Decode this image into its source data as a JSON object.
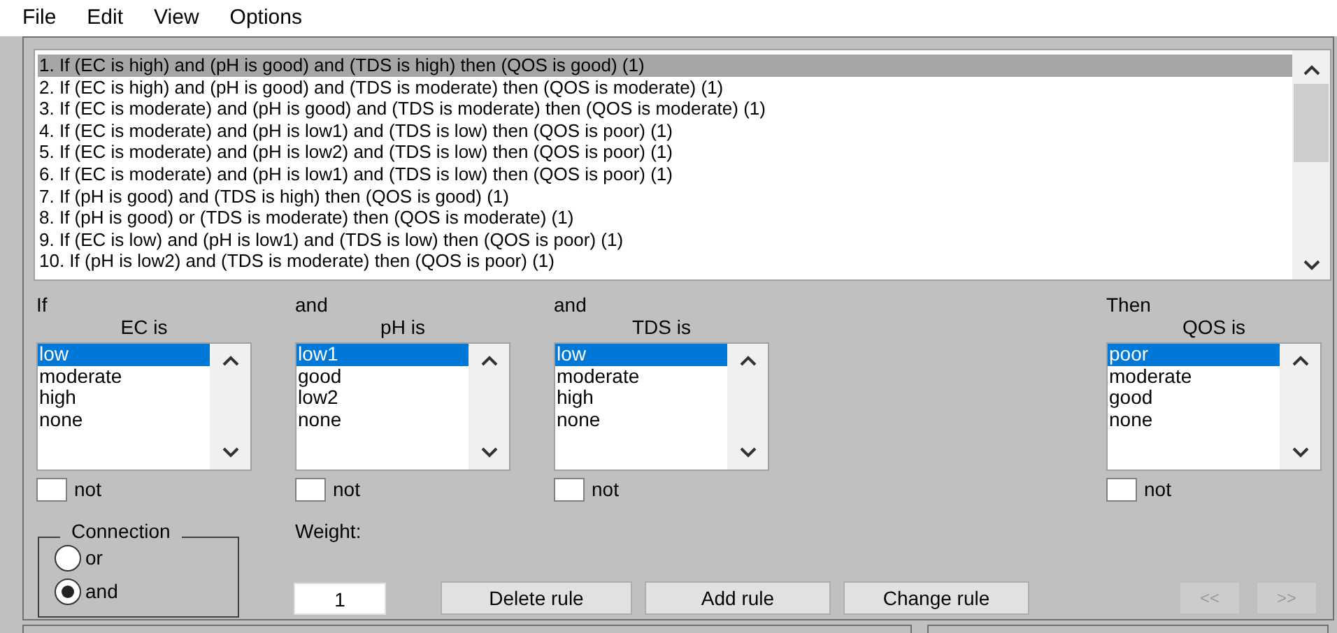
{
  "menu": [
    "File",
    "Edit",
    "View",
    "Options"
  ],
  "rules": [
    {
      "text": "1. If (EC is high) and (pH is good) and (TDS is high) then (QOS is good) (1)",
      "selected": true
    },
    {
      "text": "2. If (EC is high) and (pH is good) and (TDS is moderate) then (QOS is moderate) (1)",
      "selected": false
    },
    {
      "text": "3. If (EC is moderate) and (pH is good) and (TDS is moderate) then (QOS is moderate) (1)",
      "selected": false
    },
    {
      "text": "4. If (EC is moderate) and (pH is low1) and (TDS is low) then (QOS is poor) (1)",
      "selected": false
    },
    {
      "text": "5. If (EC is moderate) and (pH is low2) and (TDS is low) then (QOS is poor) (1)",
      "selected": false
    },
    {
      "text": "6. If (EC is moderate) and (pH is low1) and (TDS is low) then (QOS is poor) (1)",
      "selected": false
    },
    {
      "text": "7. If (pH is good) and (TDS is high) then (QOS is good) (1)",
      "selected": false
    },
    {
      "text": "8. If (pH is good) or (TDS is moderate) then (QOS is moderate) (1)",
      "selected": false
    },
    {
      "text": "9. If (EC is low) and (pH is low1) and (TDS is low) then (QOS is poor) (1)",
      "selected": false
    },
    {
      "text": "10. If (pH is low2) and (TDS is moderate) then (QOS is poor) (1)",
      "selected": false
    }
  ],
  "variables": [
    {
      "prefix": "If",
      "label": "EC is",
      "items": [
        {
          "text": "low",
          "selected": true
        },
        {
          "text": "moderate",
          "selected": false
        },
        {
          "text": "high",
          "selected": false
        },
        {
          "text": "none",
          "selected": false
        }
      ],
      "not_label": "not",
      "not_checked": false
    },
    {
      "prefix": "and",
      "label": "pH is",
      "items": [
        {
          "text": "low1",
          "selected": true
        },
        {
          "text": "good",
          "selected": false
        },
        {
          "text": "low2",
          "selected": false
        },
        {
          "text": "none",
          "selected": false
        }
      ],
      "not_label": "not",
      "not_checked": false
    },
    {
      "prefix": "and",
      "label": "TDS is",
      "items": [
        {
          "text": "low",
          "selected": true
        },
        {
          "text": "moderate",
          "selected": false
        },
        {
          "text": "high",
          "selected": false
        },
        {
          "text": "none",
          "selected": false
        }
      ],
      "not_label": "not",
      "not_checked": false
    },
    {
      "prefix": "Then",
      "label": "QOS is",
      "items": [
        {
          "text": "poor",
          "selected": true
        },
        {
          "text": "moderate",
          "selected": false
        },
        {
          "text": "good",
          "selected": false
        },
        {
          "text": "none",
          "selected": false
        }
      ],
      "not_label": "not",
      "not_checked": false
    }
  ],
  "connection": {
    "title": "Connection",
    "options": [
      {
        "label": "or",
        "selected": false
      },
      {
        "label": "and",
        "selected": true
      }
    ]
  },
  "weight": {
    "label": "Weight:",
    "value": "1"
  },
  "buttons": [
    {
      "label": "Delete rule",
      "disabled": false
    },
    {
      "label": "Add rule",
      "disabled": false
    },
    {
      "label": "Change rule",
      "disabled": false
    }
  ],
  "nav_buttons": [
    {
      "label": "<<",
      "disabled": true
    },
    {
      "label": ">>",
      "disabled": true
    }
  ]
}
